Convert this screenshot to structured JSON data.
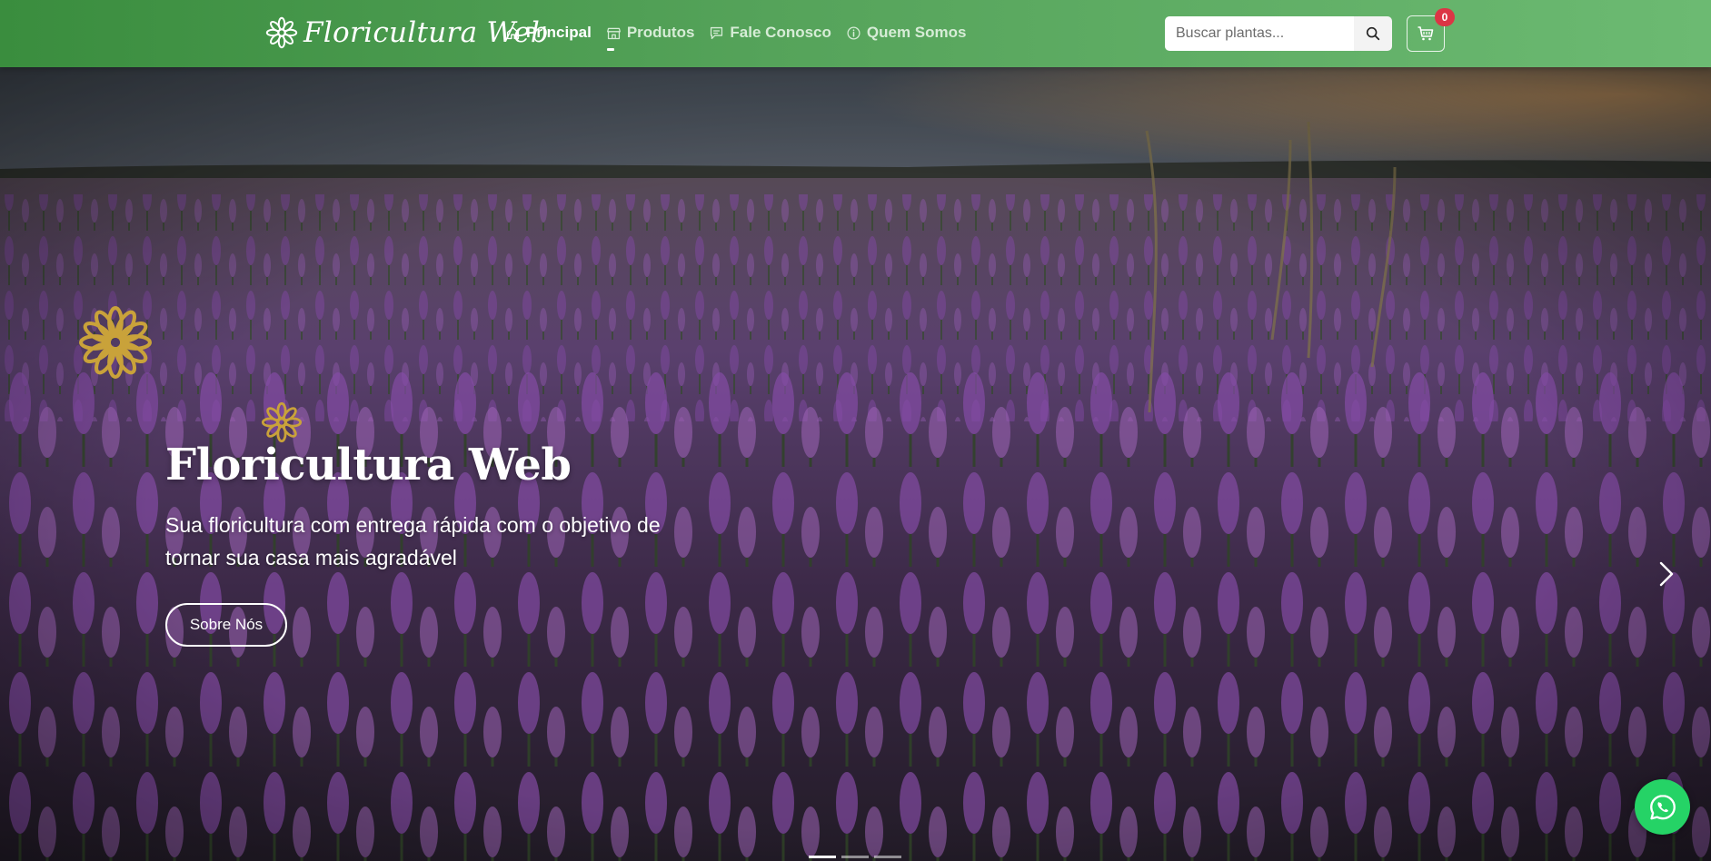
{
  "navbar": {
    "brand": "Floricultura Web",
    "links": [
      {
        "label": "Principal",
        "icon": "home-icon",
        "active": true
      },
      {
        "label": "Produtos",
        "icon": "store-icon",
        "active": false
      },
      {
        "label": "Fale Conosco",
        "icon": "chat-icon",
        "active": false
      },
      {
        "label": "Quem Somos",
        "icon": "info-icon",
        "active": false
      }
    ],
    "search": {
      "placeholder": "Buscar plantas...",
      "icon": "search-icon"
    },
    "cart": {
      "icon": "cart-icon",
      "count": "0"
    }
  },
  "hero": {
    "title": "Floricultura Web",
    "subtitle": "Sua floricultura com entrega rápida com o objetivo de tornar sua casa mais agradável",
    "button": "Sobre Nós",
    "next_icon": "chevron-right-icon",
    "slides": 3,
    "active_slide": 1
  },
  "floating": {
    "whatsapp_icon": "whatsapp-icon"
  },
  "colors": {
    "navbar_start": "#3a8d3e",
    "navbar_end": "#6cba72",
    "badge": "#dc3545",
    "whatsapp": "#25d366",
    "deco_flower": "#c9a23a"
  }
}
